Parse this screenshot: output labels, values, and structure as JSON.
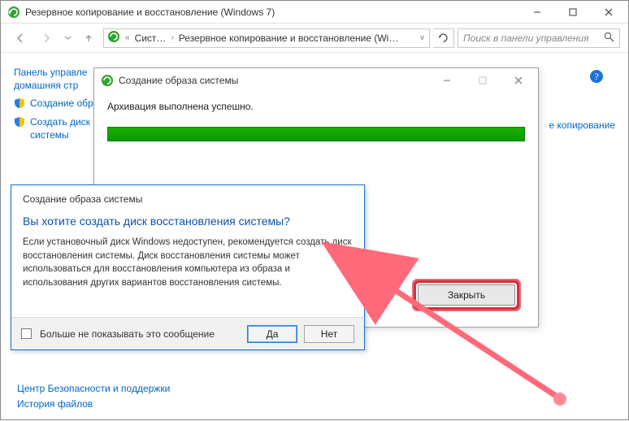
{
  "main_window": {
    "title": "Резервное копирование и восстановление (Windows 7)",
    "nav": {
      "crumb1": "Сист…",
      "crumb2": "Резервное копирование и восстановление (Wi…"
    },
    "search_placeholder": "Поиск в панели управления",
    "sidebar": {
      "cp_home1": "Панель управле",
      "cp_home2": "домашняя стр",
      "task_image": "Создание обра",
      "task_disc1": "Создать диск во",
      "task_disc2": "системы",
      "right_fragment": "е копирование",
      "seealso": [
        "Центр Безопасности и поддержки",
        "История файлов"
      ]
    }
  },
  "progress_window": {
    "title": "Создание образа системы",
    "status": "Архивация выполнена успешно.",
    "close_btn": "Закрыть"
  },
  "dialog": {
    "header": "Создание образа системы",
    "question": "Вы хотите создать диск восстановления системы?",
    "body": "Если установочный диск Windows недоступен, рекомендуется создать диск восстановления системы. Диск восстановления системы может использоваться для восстановления компьютера из образа и использования других вариантов восстановления системы.",
    "checkbox": "Больше не показывать это сообщение",
    "yes": "Да",
    "no": "Нет"
  }
}
